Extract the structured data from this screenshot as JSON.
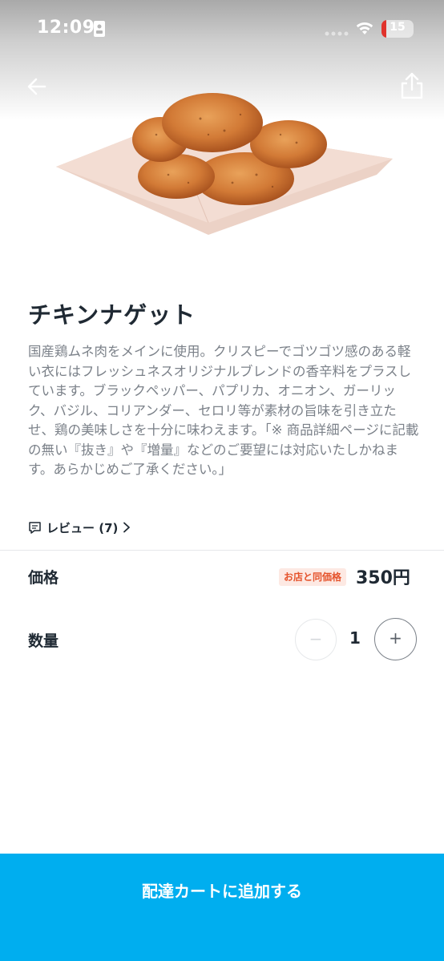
{
  "status_bar": {
    "time": "12:09",
    "battery_level": "15",
    "battery_fraction": 0.15,
    "battery_color": "#e0322b"
  },
  "header": {
    "back_icon": "arrow-left-icon",
    "share_icon": "share-icon"
  },
  "product": {
    "image_icon": "chicken-nuggets-photo",
    "title": "チキンナゲット",
    "description": "国産鶏ムネ肉をメインに使用。クリスピーでゴツゴツ感のある軽い衣にはフレッシュネスオリジナルブレンドの香辛料をプラスしています。ブラックペッパー、パプリカ、オニオン、ガーリック、バジル、コリアンダー、セロリ等が素材の旨味を引き立たせ、鶏の美味しさを十分に味わえます。「※ 商品詳細ページに記載の無い『抜き』や『増量』などのご要望には対応いたしかねます。あらかじめご了承ください。」",
    "review_label": "レビュー (7)"
  },
  "price": {
    "label": "価格",
    "badge": "お店と同価格",
    "value": "350円",
    "badge_color": "#e5532c"
  },
  "quantity": {
    "label": "数量",
    "minus": "−",
    "value": "1",
    "plus": "+"
  },
  "cta": {
    "label": "配達カートに追加する",
    "color": "#00aeef"
  }
}
